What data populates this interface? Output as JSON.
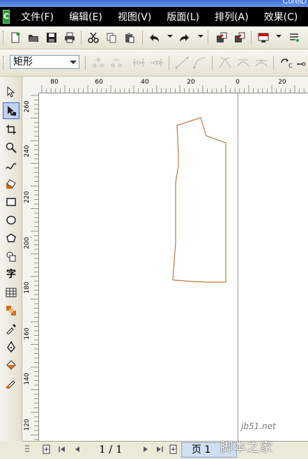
{
  "window": {
    "title_fragment": "CorelD"
  },
  "menu": [
    "文件(F)",
    "编辑(E)",
    "视图(V)",
    "版面(L)",
    "排列(A)",
    "效果(C)"
  ],
  "property_bar": {
    "object_type": "矩形"
  },
  "rulers": {
    "horizontal_ticks": [
      "80",
      "60",
      "40",
      "20",
      "0",
      "20"
    ],
    "vertical_ticks": [
      "260",
      "240",
      "220",
      "200",
      "180",
      "160",
      "140",
      "120"
    ]
  },
  "toolbox": {
    "text_tool_glyph": "字",
    "tools": [
      "pick-tool",
      "shape-tool",
      "crop-tool",
      "zoom-tool",
      "freehand-tool",
      "smart-fill-tool",
      "rectangle-tool",
      "ellipse-tool",
      "polygon-tool",
      "basic-shapes-tool",
      "text-tool",
      "table-tool",
      "interactive-tool",
      "eyedropper-tool",
      "outline-tool",
      "fill-tool",
      "interactive-fill-tool"
    ]
  },
  "status": {
    "page_counter": "1 / 1",
    "page_tab_label": "页 1"
  },
  "watermark": {
    "site": "jb51.net",
    "main": "脚本之家"
  },
  "colors": {
    "shape_outline": "#c0783c",
    "menubar_bg": "#000000",
    "active_tool": "#c1d2ee"
  }
}
